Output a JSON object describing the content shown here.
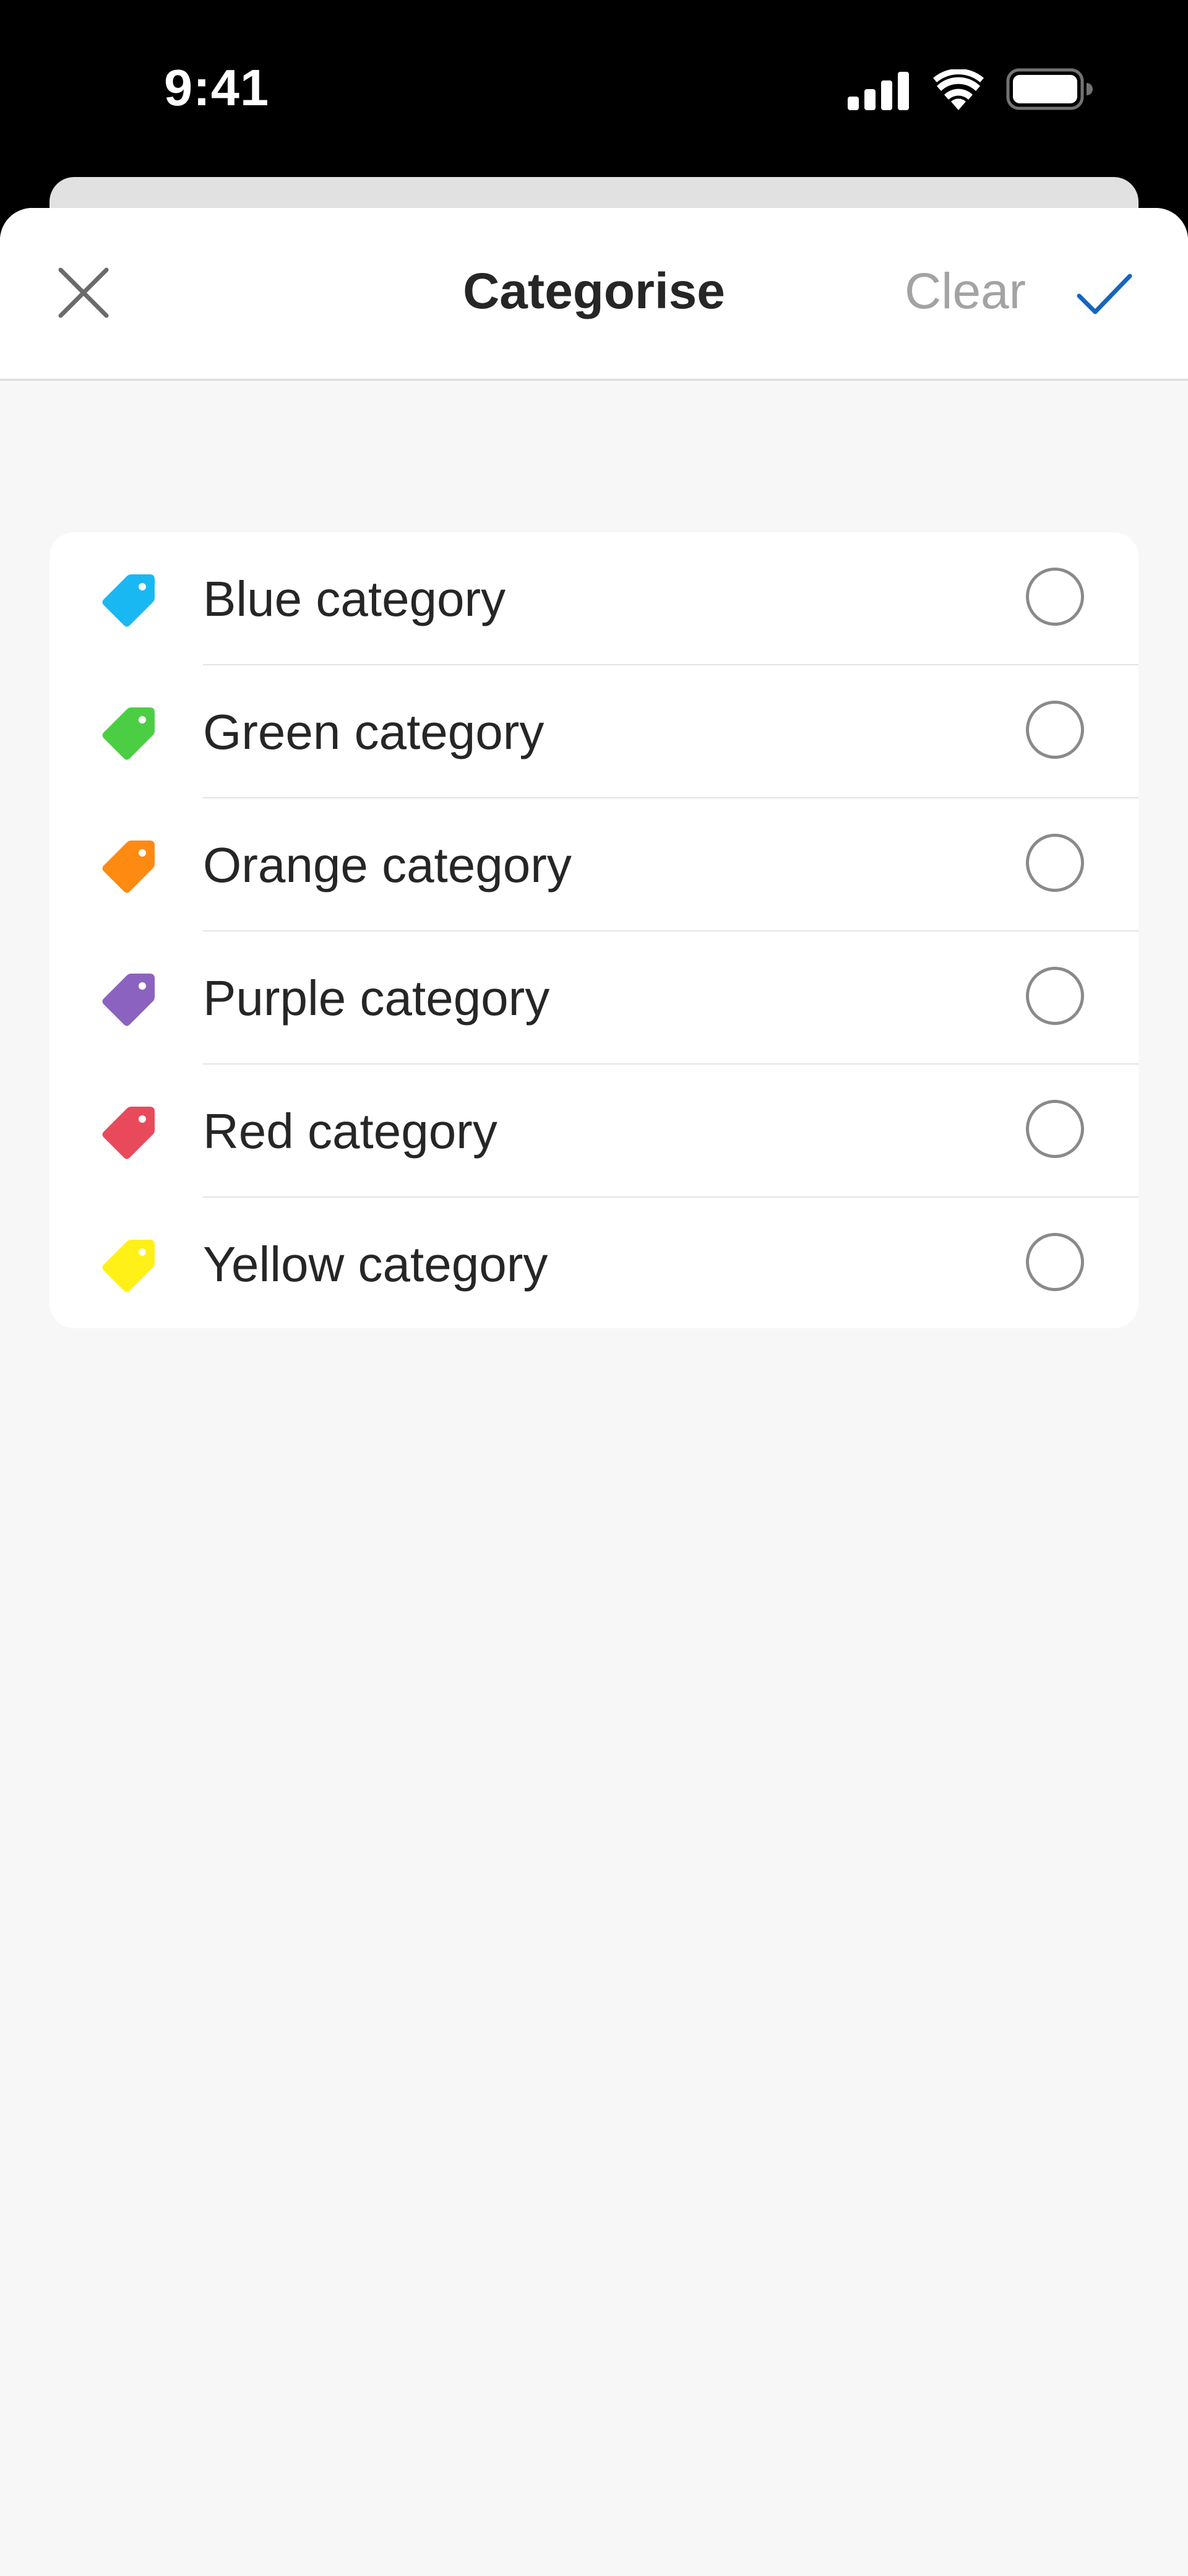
{
  "status_bar": {
    "time": "9:41",
    "icons": [
      "cellular-signal-icon",
      "wifi-icon",
      "battery-icon"
    ]
  },
  "nav": {
    "close_icon": "close-icon",
    "title": "Categorise",
    "clear_label": "Clear",
    "done_icon": "checkmark-icon",
    "done_color": "#1565c0"
  },
  "categories": [
    {
      "label": "Blue category",
      "color": "#1ab8f2",
      "selected": false
    },
    {
      "label": "Green category",
      "color": "#4cce44",
      "selected": false
    },
    {
      "label": "Orange category",
      "color": "#ff8a12",
      "selected": false
    },
    {
      "label": "Purple category",
      "color": "#8c62c0",
      "selected": false
    },
    {
      "label": "Red category",
      "color": "#e94a5b",
      "selected": false
    },
    {
      "label": "Yellow category",
      "color": "#fff017",
      "selected": false
    }
  ]
}
